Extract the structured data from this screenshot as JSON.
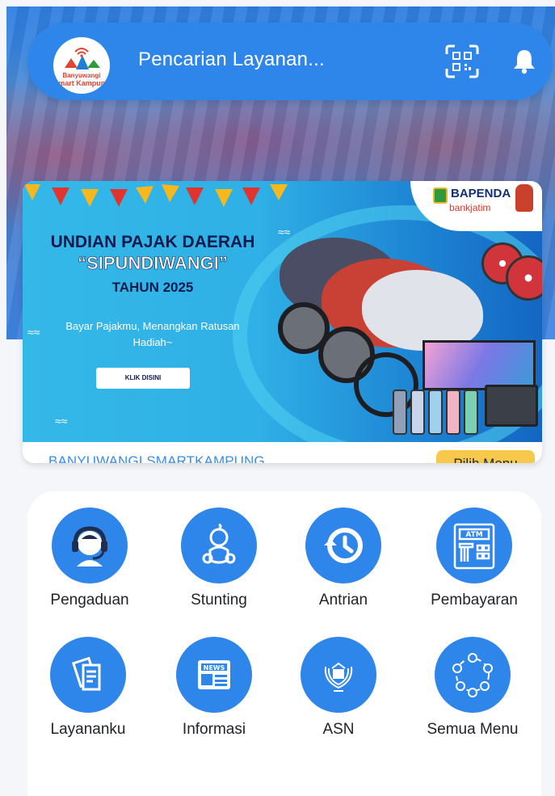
{
  "header": {
    "logo_line1": "Banyuwangi",
    "logo_line2": "Smart Kampung",
    "search_placeholder": "Pencarian Layanan...",
    "qr_icon": "qr-scan-icon",
    "bell_icon": "bell-icon"
  },
  "banner": {
    "title_line1": "UNDIAN PAJAK DAERAH",
    "title_line2": "“SIPUNDIWANGI”",
    "year": "TAHUN 2025",
    "subtitle": "Bayar Pajakmu, Menangkan Ratusan Hadiah~",
    "cta": "KLIK DISINI",
    "brand_primary": "BAPENDA",
    "brand_secondary": "bankjatim"
  },
  "section": {
    "label": "BANYUWANGI SMARTKAMPUNG",
    "pilih_menu": "Pilih Menu"
  },
  "menu": {
    "items": [
      {
        "label": "Pengaduan",
        "icon": "customer-service-icon"
      },
      {
        "label": "Stunting",
        "icon": "baby-icon"
      },
      {
        "label": "Antrian",
        "icon": "history-clock-icon"
      },
      {
        "label": "Pembayaran",
        "icon": "atm-icon"
      },
      {
        "label": "Layananku",
        "icon": "documents-icon"
      },
      {
        "label": "Informasi",
        "icon": "news-icon"
      },
      {
        "label": "ASN",
        "icon": "asn-emblem-icon"
      },
      {
        "label": "Semua Menu",
        "icon": "all-menu-icon"
      }
    ]
  },
  "colors": {
    "primary": "#2f86ea",
    "accent": "#f8c84a",
    "section_label": "#3b8ee8"
  }
}
